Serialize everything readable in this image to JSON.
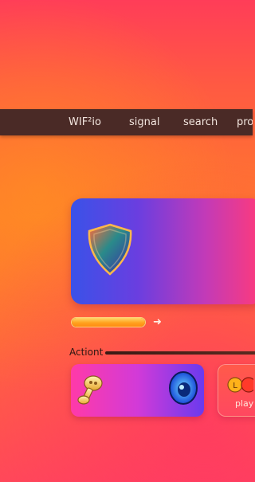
{
  "nav": {
    "items": [
      {
        "label": "WIF²io"
      },
      {
        "label": "signal"
      },
      {
        "label": "search"
      },
      {
        "label": "pro"
      }
    ]
  },
  "hero": {
    "icon": "shield-icon"
  },
  "progress": {
    "fraction": 1.0,
    "icon": "arrow-right-icon"
  },
  "action": {
    "label": "Actiont"
  },
  "tiles": {
    "main": {
      "icons": [
        "key-icon",
        "eye-icon"
      ]
    },
    "play": {
      "label": "play",
      "icon": "coins-icon"
    }
  },
  "colors": {
    "nav_bg": "#4a2a26",
    "accent_orange": "#ffa21f",
    "hero_start": "#3a52e8",
    "hero_end": "#ff3a7a"
  }
}
